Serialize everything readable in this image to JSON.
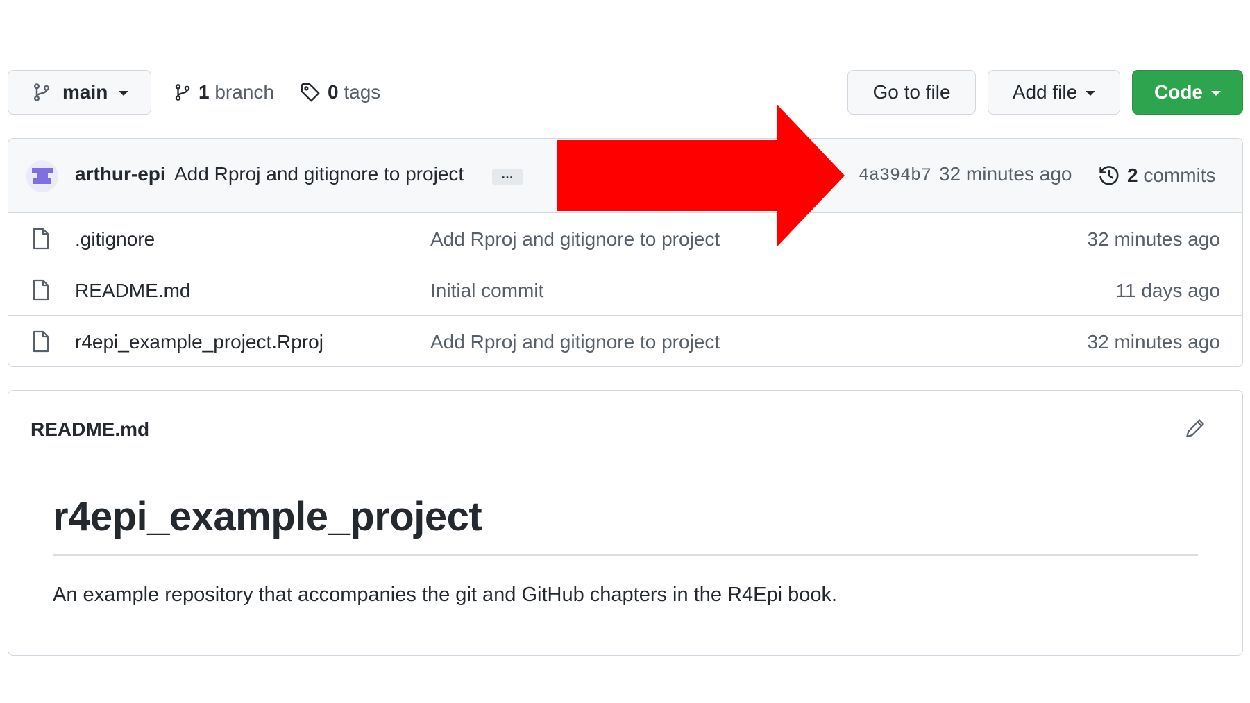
{
  "toolbar": {
    "branch_name": "main",
    "branch_count": "1",
    "branch_label": "branch",
    "tag_count": "0",
    "tag_label": "tags",
    "go_to_file": "Go to file",
    "add_file": "Add file",
    "code": "Code"
  },
  "latest_commit": {
    "author": "arthur-epi",
    "message": "Add Rproj and gitignore to project",
    "ellipsis": "…",
    "sha": "4a394b7",
    "time": "32 minutes ago",
    "commit_count": "2",
    "commit_label": "commits"
  },
  "files": [
    {
      "name": ".gitignore",
      "message": "Add Rproj and gitignore to project",
      "time": "32 minutes ago"
    },
    {
      "name": "README.md",
      "message": "Initial commit",
      "time": "11 days ago"
    },
    {
      "name": "r4epi_example_project.Rproj",
      "message": "Add Rproj and gitignore to project",
      "time": "32 minutes ago"
    }
  ],
  "readme": {
    "filename": "README.md",
    "title": "r4epi_example_project",
    "text": "An example repository that accompanies the git and GitHub chapters in the R4Epi book."
  },
  "icons": {
    "branch": "git-branch-icon",
    "tag": "tag-icon",
    "history": "history-icon",
    "file": "file-icon",
    "edit": "pencil-icon",
    "annotation": "red-arrow"
  },
  "colors": {
    "code_button": "#2da44e",
    "arrow": "#ff0000",
    "border": "#d0d7de",
    "muted_text": "#57606a"
  }
}
